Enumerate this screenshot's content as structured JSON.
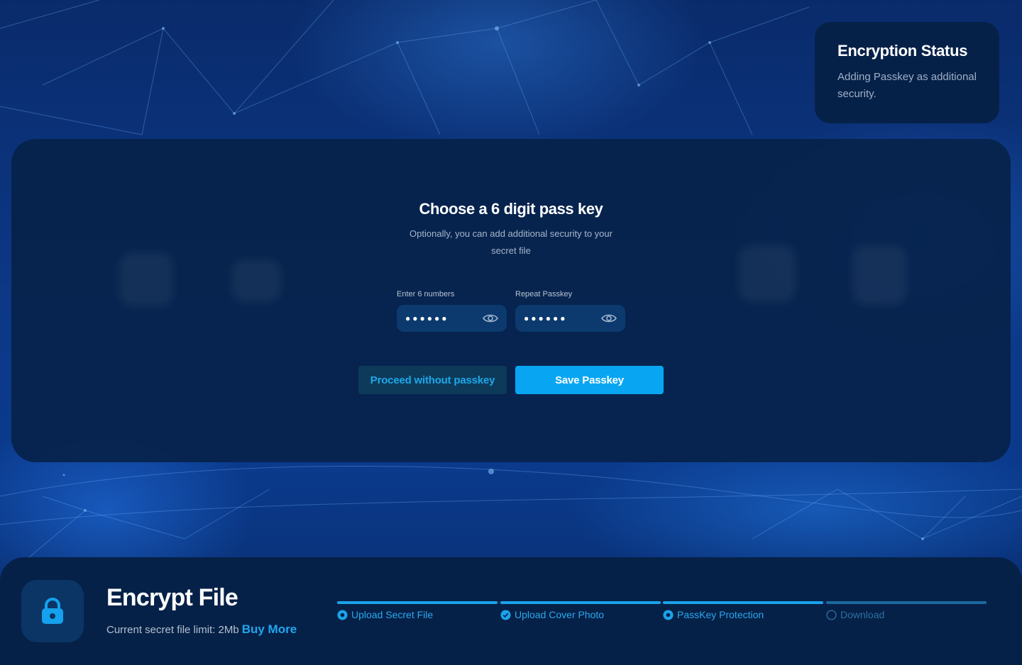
{
  "status": {
    "title": "Encryption Status",
    "description": "Adding Passkey as additional security."
  },
  "modal": {
    "title": "Choose a 6 digit pass key",
    "subtitle": "Optionally, you can add additional security to your secret file",
    "field1": {
      "label": "Enter 6 numbers",
      "value": "●●●●●●"
    },
    "field2": {
      "label": "Repeat Passkey",
      "value": "●●●●●●"
    },
    "secondary_button": "Proceed without passkey",
    "primary_button": "Save Passkey"
  },
  "footer": {
    "title": "Encrypt File",
    "limit_text": "Current secret file limit: 2Mb",
    "buy_more": "Buy More",
    "steps": [
      {
        "label": "Upload Secret File",
        "state": "current-dot"
      },
      {
        "label": "Upload Cover Photo",
        "state": "done"
      },
      {
        "label": "PassKey Protection",
        "state": "current-dot"
      },
      {
        "label": "Download",
        "state": "pending"
      }
    ]
  },
  "colors": {
    "accent": "#08a6f2",
    "card": "#062148",
    "background": "#0b3a8c"
  },
  "icons": [
    "lock-icon",
    "eye-icon",
    "check-circle-icon",
    "radio-dot-icon",
    "empty-circle-icon"
  ]
}
